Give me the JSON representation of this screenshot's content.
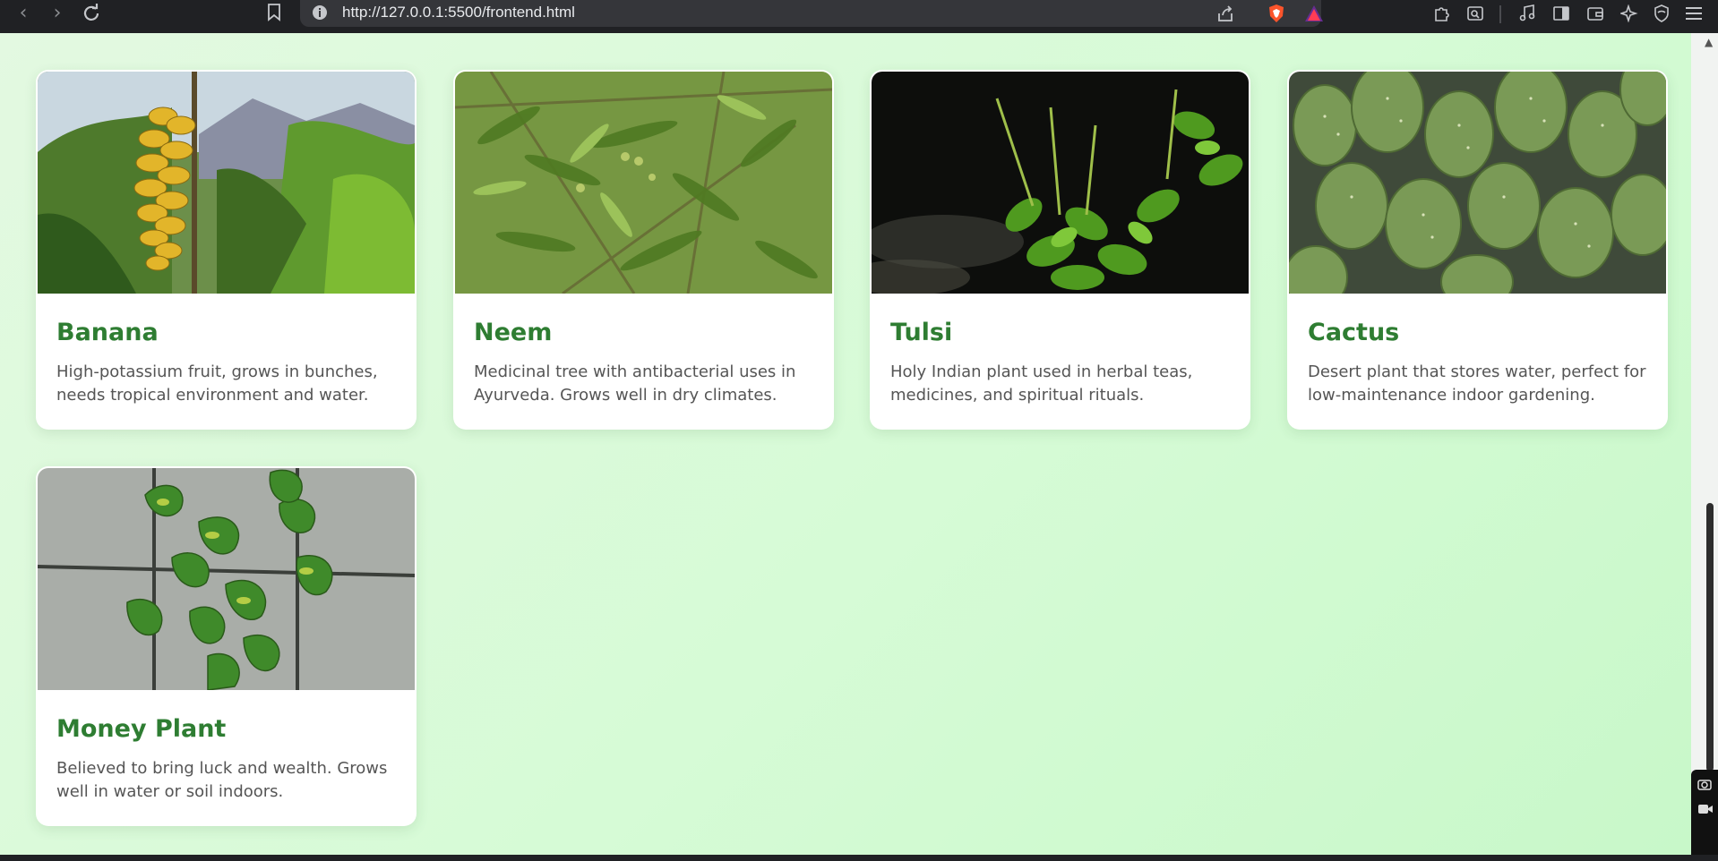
{
  "browser": {
    "url": "http://127.0.0.1:5500/frontend.html"
  },
  "icons": {
    "back": "back-arrow-icon",
    "forward": "forward-arrow-icon",
    "reload": "reload-icon",
    "bookmark": "bookmark-icon",
    "info": "info-icon",
    "share": "share-icon",
    "brave": "brave-shield-icon",
    "rewards": "rewards-triangle-icon",
    "extensions": "puzzle-icon",
    "find": "find-in-page-icon",
    "media": "music-note-icon",
    "sidebar": "sidebar-icon",
    "wallet": "wallet-icon",
    "leo": "sparkle-icon",
    "vpn": "shield-icon",
    "menu": "hamburger-menu-icon"
  },
  "colors": {
    "title_green": "#2e7d32",
    "desc_gray": "#555555",
    "background": "#d6fbd6"
  },
  "plants": [
    {
      "name": "Banana",
      "description": "High-potassium fruit, grows in bunches, needs tropical environment and water."
    },
    {
      "name": "Neem",
      "description": "Medicinal tree with antibacterial uses in Ayurveda. Grows well in dry climates."
    },
    {
      "name": "Tulsi",
      "description": "Holy Indian plant used in herbal teas, medicines, and spiritual rituals."
    },
    {
      "name": "Cactus",
      "description": "Desert plant that stores water, perfect for low-maintenance indoor gardening."
    },
    {
      "name": "Money Plant",
      "description": "Believed to bring luck and wealth. Grows well in water or soil indoors."
    }
  ]
}
